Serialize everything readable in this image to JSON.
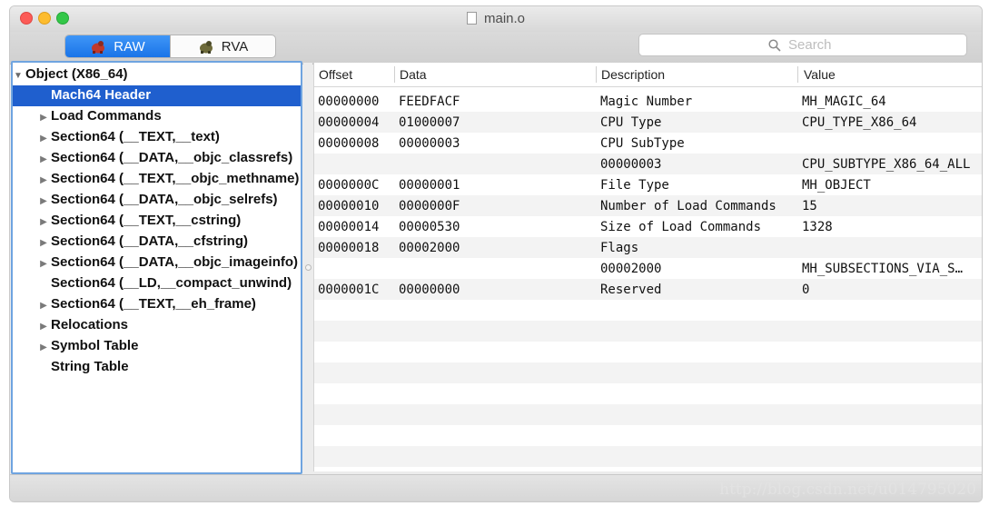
{
  "window": {
    "title": "main.o"
  },
  "toolbar": {
    "segments": [
      {
        "label": "RAW",
        "selected": true
      },
      {
        "label": "RVA",
        "selected": false
      }
    ],
    "search_placeholder": "Search"
  },
  "sidebar": {
    "root": "Object (X86_64)",
    "items": [
      {
        "label": "Mach64 Header",
        "expandable": false,
        "selected": true
      },
      {
        "label": "Load Commands",
        "expandable": true
      },
      {
        "label": "Section64 (__TEXT,__text)",
        "expandable": true
      },
      {
        "label": "Section64 (__DATA,__objc_classrefs)",
        "expandable": true
      },
      {
        "label": "Section64 (__TEXT,__objc_methname)",
        "expandable": true
      },
      {
        "label": "Section64 (__DATA,__objc_selrefs)",
        "expandable": true
      },
      {
        "label": "Section64 (__TEXT,__cstring)",
        "expandable": true
      },
      {
        "label": "Section64 (__DATA,__cfstring)",
        "expandable": true
      },
      {
        "label": "Section64 (__DATA,__objc_imageinfo)",
        "expandable": true
      },
      {
        "label": "Section64 (__LD,__compact_unwind)",
        "expandable": false
      },
      {
        "label": "Section64 (__TEXT,__eh_frame)",
        "expandable": true
      },
      {
        "label": "Relocations",
        "expandable": true
      },
      {
        "label": "Symbol Table",
        "expandable": true
      },
      {
        "label": "String Table",
        "expandable": false
      }
    ]
  },
  "table": {
    "columns": [
      "Offset",
      "Data",
      "Description",
      "Value"
    ],
    "rows": [
      {
        "offset": "00000000",
        "data": "FEEDFACF",
        "description": "Magic Number",
        "value": "MH_MAGIC_64"
      },
      {
        "offset": "00000004",
        "data": "01000007",
        "description": "CPU Type",
        "value": "CPU_TYPE_X86_64"
      },
      {
        "offset": "00000008",
        "data": "00000003",
        "description": "CPU SubType",
        "value": ""
      },
      {
        "offset": "",
        "data": "",
        "description": "00000003",
        "value": "CPU_SUBTYPE_X86_64_ALL"
      },
      {
        "offset": "0000000C",
        "data": "00000001",
        "description": "File Type",
        "value": "MH_OBJECT"
      },
      {
        "offset": "00000010",
        "data": "0000000F",
        "description": "Number of Load Commands",
        "value": "15"
      },
      {
        "offset": "00000014",
        "data": "00000530",
        "description": "Size of Load Commands",
        "value": "1328"
      },
      {
        "offset": "00000018",
        "data": "00002000",
        "description": "Flags",
        "value": ""
      },
      {
        "offset": "",
        "data": "",
        "description": "00002000",
        "value": "MH_SUBSECTIONS_VIA_S…"
      },
      {
        "offset": "0000001C",
        "data": "00000000",
        "description": "Reserved",
        "value": "0"
      }
    ]
  },
  "watermark": "http://blog.csdn.net/u014795020",
  "colors": {
    "selection": "#1f5fce",
    "segment_active": "#1a74e8"
  }
}
